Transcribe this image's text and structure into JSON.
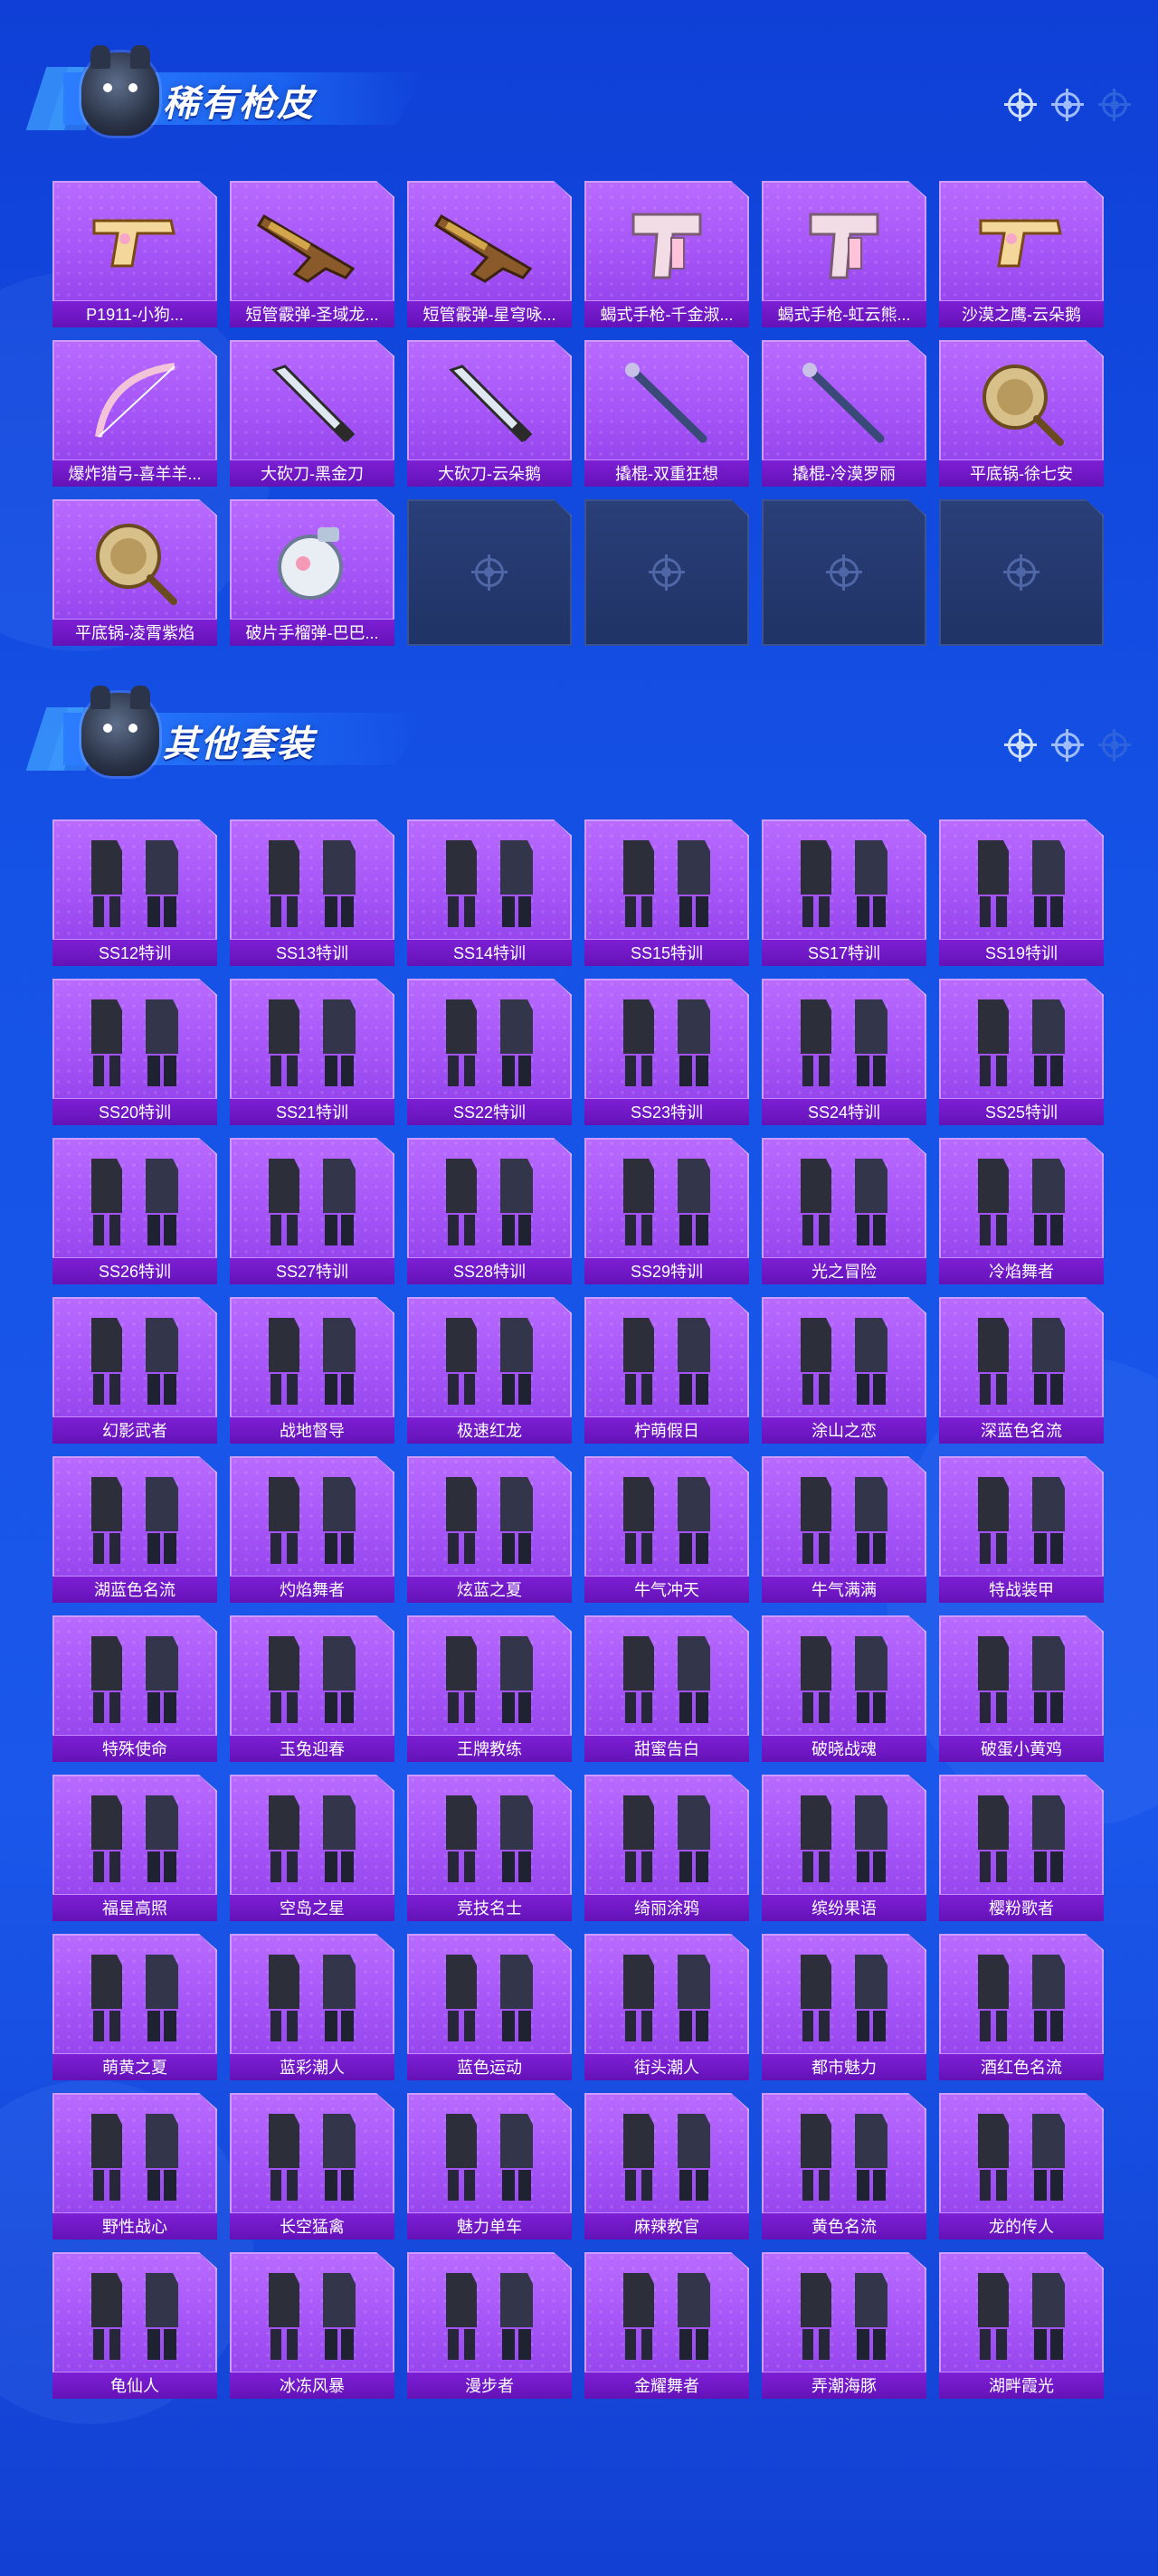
{
  "colors": {
    "background": "#1552e6",
    "card_purple": "#a352f6",
    "label_bar": "#6f16c4",
    "empty_card": "#263a70",
    "title_text": "#ffffff"
  },
  "sections": {
    "rare": {
      "title": "稀有枪皮",
      "icon": "penguin-mascot-icon",
      "items": [
        {
          "label": "P1911-小狗...",
          "icon": "pistol-icon"
        },
        {
          "label": "短管霰弹-圣域龙...",
          "icon": "shotgun-icon"
        },
        {
          "label": "短管霰弹-星穹咏...",
          "icon": "shotgun-icon"
        },
        {
          "label": "蝎式手枪-千金淑...",
          "icon": "smg-icon"
        },
        {
          "label": "蝎式手枪-虹云熊...",
          "icon": "smg-icon"
        },
        {
          "label": "沙漠之鹰-云朵鹅",
          "icon": "pistol-icon"
        },
        {
          "label": "爆炸猎弓-喜羊羊...",
          "icon": "bow-icon"
        },
        {
          "label": "大砍刀-黑金刀",
          "icon": "machete-icon"
        },
        {
          "label": "大砍刀-云朵鹅",
          "icon": "machete-icon"
        },
        {
          "label": "撬棍-双重狂想",
          "icon": "crowbar-icon"
        },
        {
          "label": "撬棍-冷漠罗丽",
          "icon": "crowbar-icon"
        },
        {
          "label": "平底锅-徐七安",
          "icon": "pan-icon"
        },
        {
          "label": "平底锅-凌霄紫焰",
          "icon": "pan-icon"
        },
        {
          "label": "破片手榴弹-巴巴...",
          "icon": "grenade-icon"
        }
      ],
      "empty_slots": 4,
      "empty_icon": "crosshair-icon"
    },
    "outfits": {
      "title": "其他套装",
      "icon": "penguin-mascot-icon",
      "items": [
        {
          "label": "SS12特训",
          "icon": "outfit-icon"
        },
        {
          "label": "SS13特训",
          "icon": "outfit-icon"
        },
        {
          "label": "SS14特训",
          "icon": "outfit-icon"
        },
        {
          "label": "SS15特训",
          "icon": "outfit-icon"
        },
        {
          "label": "SS17特训",
          "icon": "outfit-icon"
        },
        {
          "label": "SS19特训",
          "icon": "outfit-icon"
        },
        {
          "label": "SS20特训",
          "icon": "outfit-icon"
        },
        {
          "label": "SS21特训",
          "icon": "outfit-icon"
        },
        {
          "label": "SS22特训",
          "icon": "outfit-icon"
        },
        {
          "label": "SS23特训",
          "icon": "outfit-icon"
        },
        {
          "label": "SS24特训",
          "icon": "outfit-icon"
        },
        {
          "label": "SS25特训",
          "icon": "outfit-icon"
        },
        {
          "label": "SS26特训",
          "icon": "outfit-icon"
        },
        {
          "label": "SS27特训",
          "icon": "outfit-icon"
        },
        {
          "label": "SS28特训",
          "icon": "outfit-icon"
        },
        {
          "label": "SS29特训",
          "icon": "outfit-icon"
        },
        {
          "label": "光之冒险",
          "icon": "outfit-icon"
        },
        {
          "label": "冷焰舞者",
          "icon": "outfit-icon"
        },
        {
          "label": "幻影武者",
          "icon": "outfit-icon"
        },
        {
          "label": "战地督导",
          "icon": "outfit-icon"
        },
        {
          "label": "极速红龙",
          "icon": "outfit-icon"
        },
        {
          "label": "柠萌假日",
          "icon": "outfit-icon"
        },
        {
          "label": "涂山之恋",
          "icon": "outfit-icon"
        },
        {
          "label": "深蓝色名流",
          "icon": "outfit-icon"
        },
        {
          "label": "湖蓝色名流",
          "icon": "outfit-icon"
        },
        {
          "label": "灼焰舞者",
          "icon": "outfit-icon"
        },
        {
          "label": "炫蓝之夏",
          "icon": "outfit-icon"
        },
        {
          "label": "牛气冲天",
          "icon": "outfit-icon"
        },
        {
          "label": "牛气满满",
          "icon": "outfit-icon"
        },
        {
          "label": "特战装甲",
          "icon": "outfit-icon"
        },
        {
          "label": "特殊使命",
          "icon": "outfit-icon"
        },
        {
          "label": "玉兔迎春",
          "icon": "outfit-icon"
        },
        {
          "label": "王牌教练",
          "icon": "outfit-icon"
        },
        {
          "label": "甜蜜告白",
          "icon": "outfit-icon"
        },
        {
          "label": "破晓战魂",
          "icon": "outfit-icon"
        },
        {
          "label": "破蛋小黄鸡",
          "icon": "outfit-icon"
        },
        {
          "label": "福星高照",
          "icon": "outfit-icon"
        },
        {
          "label": "空岛之星",
          "icon": "outfit-icon"
        },
        {
          "label": "竞技名士",
          "icon": "outfit-icon"
        },
        {
          "label": "绮丽涂鸦",
          "icon": "outfit-icon"
        },
        {
          "label": "缤纷果语",
          "icon": "outfit-icon"
        },
        {
          "label": "樱粉歌者",
          "icon": "outfit-icon"
        },
        {
          "label": "萌黄之夏",
          "icon": "outfit-icon"
        },
        {
          "label": "蓝彩潮人",
          "icon": "outfit-icon"
        },
        {
          "label": "蓝色运动",
          "icon": "outfit-icon"
        },
        {
          "label": "街头潮人",
          "icon": "outfit-icon"
        },
        {
          "label": "都市魅力",
          "icon": "outfit-icon"
        },
        {
          "label": "酒红色名流",
          "icon": "outfit-icon"
        },
        {
          "label": "野性战心",
          "icon": "outfit-icon"
        },
        {
          "label": "长空猛禽",
          "icon": "outfit-icon"
        },
        {
          "label": "魅力单车",
          "icon": "outfit-icon"
        },
        {
          "label": "麻辣教官",
          "icon": "outfit-icon"
        },
        {
          "label": "黄色名流",
          "icon": "outfit-icon"
        },
        {
          "label": "龙的传人",
          "icon": "outfit-icon"
        },
        {
          "label": "龟仙人",
          "icon": "outfit-icon"
        },
        {
          "label": "冰冻风暴",
          "icon": "outfit-icon"
        },
        {
          "label": "漫步者",
          "icon": "outfit-icon"
        },
        {
          "label": "金耀舞者",
          "icon": "outfit-icon"
        },
        {
          "label": "弄潮海豚",
          "icon": "outfit-icon"
        },
        {
          "label": "湖畔霞光",
          "icon": "outfit-icon"
        }
      ]
    }
  },
  "header_icons": [
    "crosshair-icon",
    "crosshair-icon",
    "crosshair-icon"
  ]
}
